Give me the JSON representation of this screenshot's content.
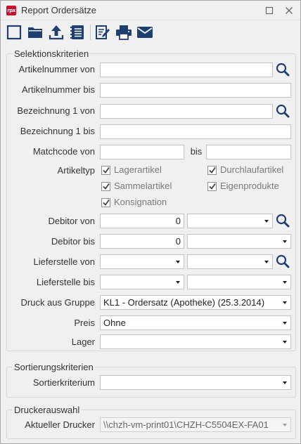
{
  "window": {
    "title": "Report Ordersätze",
    "app_logo": "rpx"
  },
  "toolbar": {
    "icons": [
      "new-document-icon",
      "open-folder-icon",
      "upload-icon",
      "report-list-icon",
      "edit-icon",
      "print-icon",
      "mail-icon"
    ]
  },
  "selection": {
    "legend": "Selektionskriterien",
    "artikelnummer_von": {
      "label": "Artikelnummer von",
      "value": ""
    },
    "artikelnummer_bis": {
      "label": "Artikelnummer bis",
      "value": ""
    },
    "bezeichnung_von": {
      "label": "Bezeichnung 1 von",
      "value": ""
    },
    "bezeichnung_bis": {
      "label": "Bezeichnung 1 bis",
      "value": ""
    },
    "matchcode": {
      "label": "Matchcode von",
      "bis_label": "bis",
      "von_value": "",
      "bis_value": ""
    },
    "artikeltyp": {
      "label": "Artikeltyp",
      "options": [
        {
          "label": "Lagerartikel",
          "checked": true
        },
        {
          "label": "Durchlaufartikel",
          "checked": true
        },
        {
          "label": "Sammelartikel",
          "checked": true
        },
        {
          "label": "Eigenprodukte",
          "checked": true
        },
        {
          "label": "Konsignation",
          "checked": true
        }
      ]
    },
    "debitor_von": {
      "label": "Debitor von",
      "value": "0",
      "combo_value": ""
    },
    "debitor_bis": {
      "label": "Debitor bis",
      "value": "0",
      "combo_value": ""
    },
    "lieferstelle_von": {
      "label": "Lieferstelle von",
      "value": "",
      "combo_value": ""
    },
    "lieferstelle_bis": {
      "label": "Lieferstelle bis",
      "value": "",
      "combo_value": ""
    },
    "druck_gruppe": {
      "label": "Druck aus Gruppe",
      "value": "KL1 - Ordersatz (Apotheke) (25.3.2014)"
    },
    "preis": {
      "label": "Preis",
      "value": "Ohne"
    },
    "lager": {
      "label": "Lager",
      "value": ""
    }
  },
  "sorting": {
    "legend": "Sortierungskriterien",
    "kriterium": {
      "label": "Sortierkriterium",
      "value": ""
    }
  },
  "printer": {
    "legend": "Druckerauswahl",
    "current": {
      "label": "Aktueller Drucker",
      "value": "\\\\chzh-vm-print01\\CHZH-C5504EX-FA01"
    }
  },
  "colors": {
    "accent": "#1f3f6e",
    "logo": "#c8102e"
  }
}
